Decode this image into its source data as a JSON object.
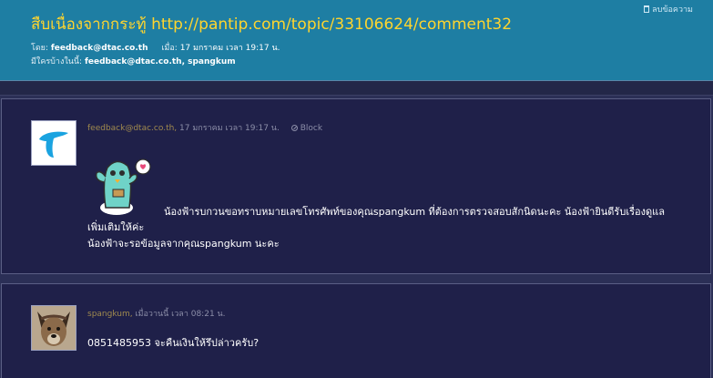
{
  "topic": {
    "title": "สืบเนื่องจากกระทู้ http://pantip.com/topic/33106624/comment32",
    "delete_label": "ลบข้อความ",
    "by_label": "โดย:",
    "by_value": "feedback@dtac.co.th",
    "when_label": "เมื่อ:",
    "when_value": "17 มกราคม เวลา 19:17 น.",
    "participants_label": "มีใครบ้างในนี้:",
    "participants_value": "feedback@dtac.co.th, spangkum"
  },
  "posts": [
    {
      "author": "feedback@dtac.co.th,",
      "time": "17 มกราคม เวลา 19:17 น.",
      "block_label": "Block",
      "avatar_icon": "dtac-logo-icon",
      "sticker_icon": "cactus-sticker-icon",
      "message_line1": "น้องฟ้ารบกวนขอทราบหมายเลขโทรศัพท์ของคุณspangkum ที่ต้องการตรวจสอบสักนิดนะคะ น้องฟ้ายินดีรับเรื่องดูแล",
      "message_line2": "เพิ่มเติมให้ค่ะ",
      "message_line3": "น้องฟ้าจะรอข้อมูลจากคุณspangkum นะคะ"
    },
    {
      "author": "spangkum,",
      "time": "เมื่อวานนี้ เวลา 08:21 น.",
      "avatar_icon": "dog-photo-icon",
      "message_line1": "0851485953 จะคืนเงินให้รึปล่าวครับ?"
    }
  ],
  "colors": {
    "header_bg": "#1e7ea3",
    "title": "#ffd52e",
    "page_bg": "#2b2f56",
    "post_bg": "#1f2049",
    "author": "#a08a4e"
  }
}
